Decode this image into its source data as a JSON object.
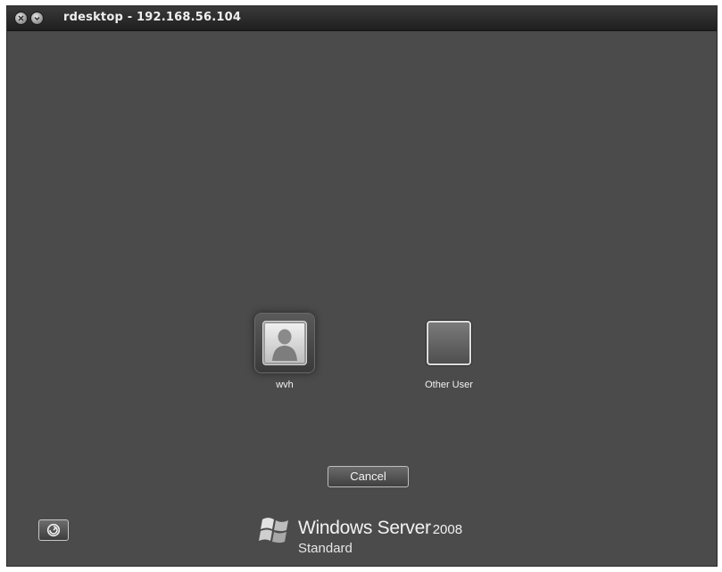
{
  "window": {
    "title": "rdesktop - 192.168.56.104",
    "controls": [
      "close-icon",
      "minimize-icon"
    ]
  },
  "login": {
    "users": [
      {
        "label": "wvh",
        "icon": "user-avatar-icon",
        "selected": true
      },
      {
        "label": "Other User",
        "icon": "blank-avatar-icon",
        "selected": false
      }
    ],
    "cancel_label": "Cancel",
    "ease_of_access_icon": "ease-of-access-icon"
  },
  "branding": {
    "logo": "windows-flag-logo",
    "product": "Windows Server",
    "version": "2008",
    "edition": "Standard"
  },
  "colors": {
    "background": "#4b4b4b",
    "titlebar": "#2a2a2a",
    "text": "#f2f2f2"
  }
}
